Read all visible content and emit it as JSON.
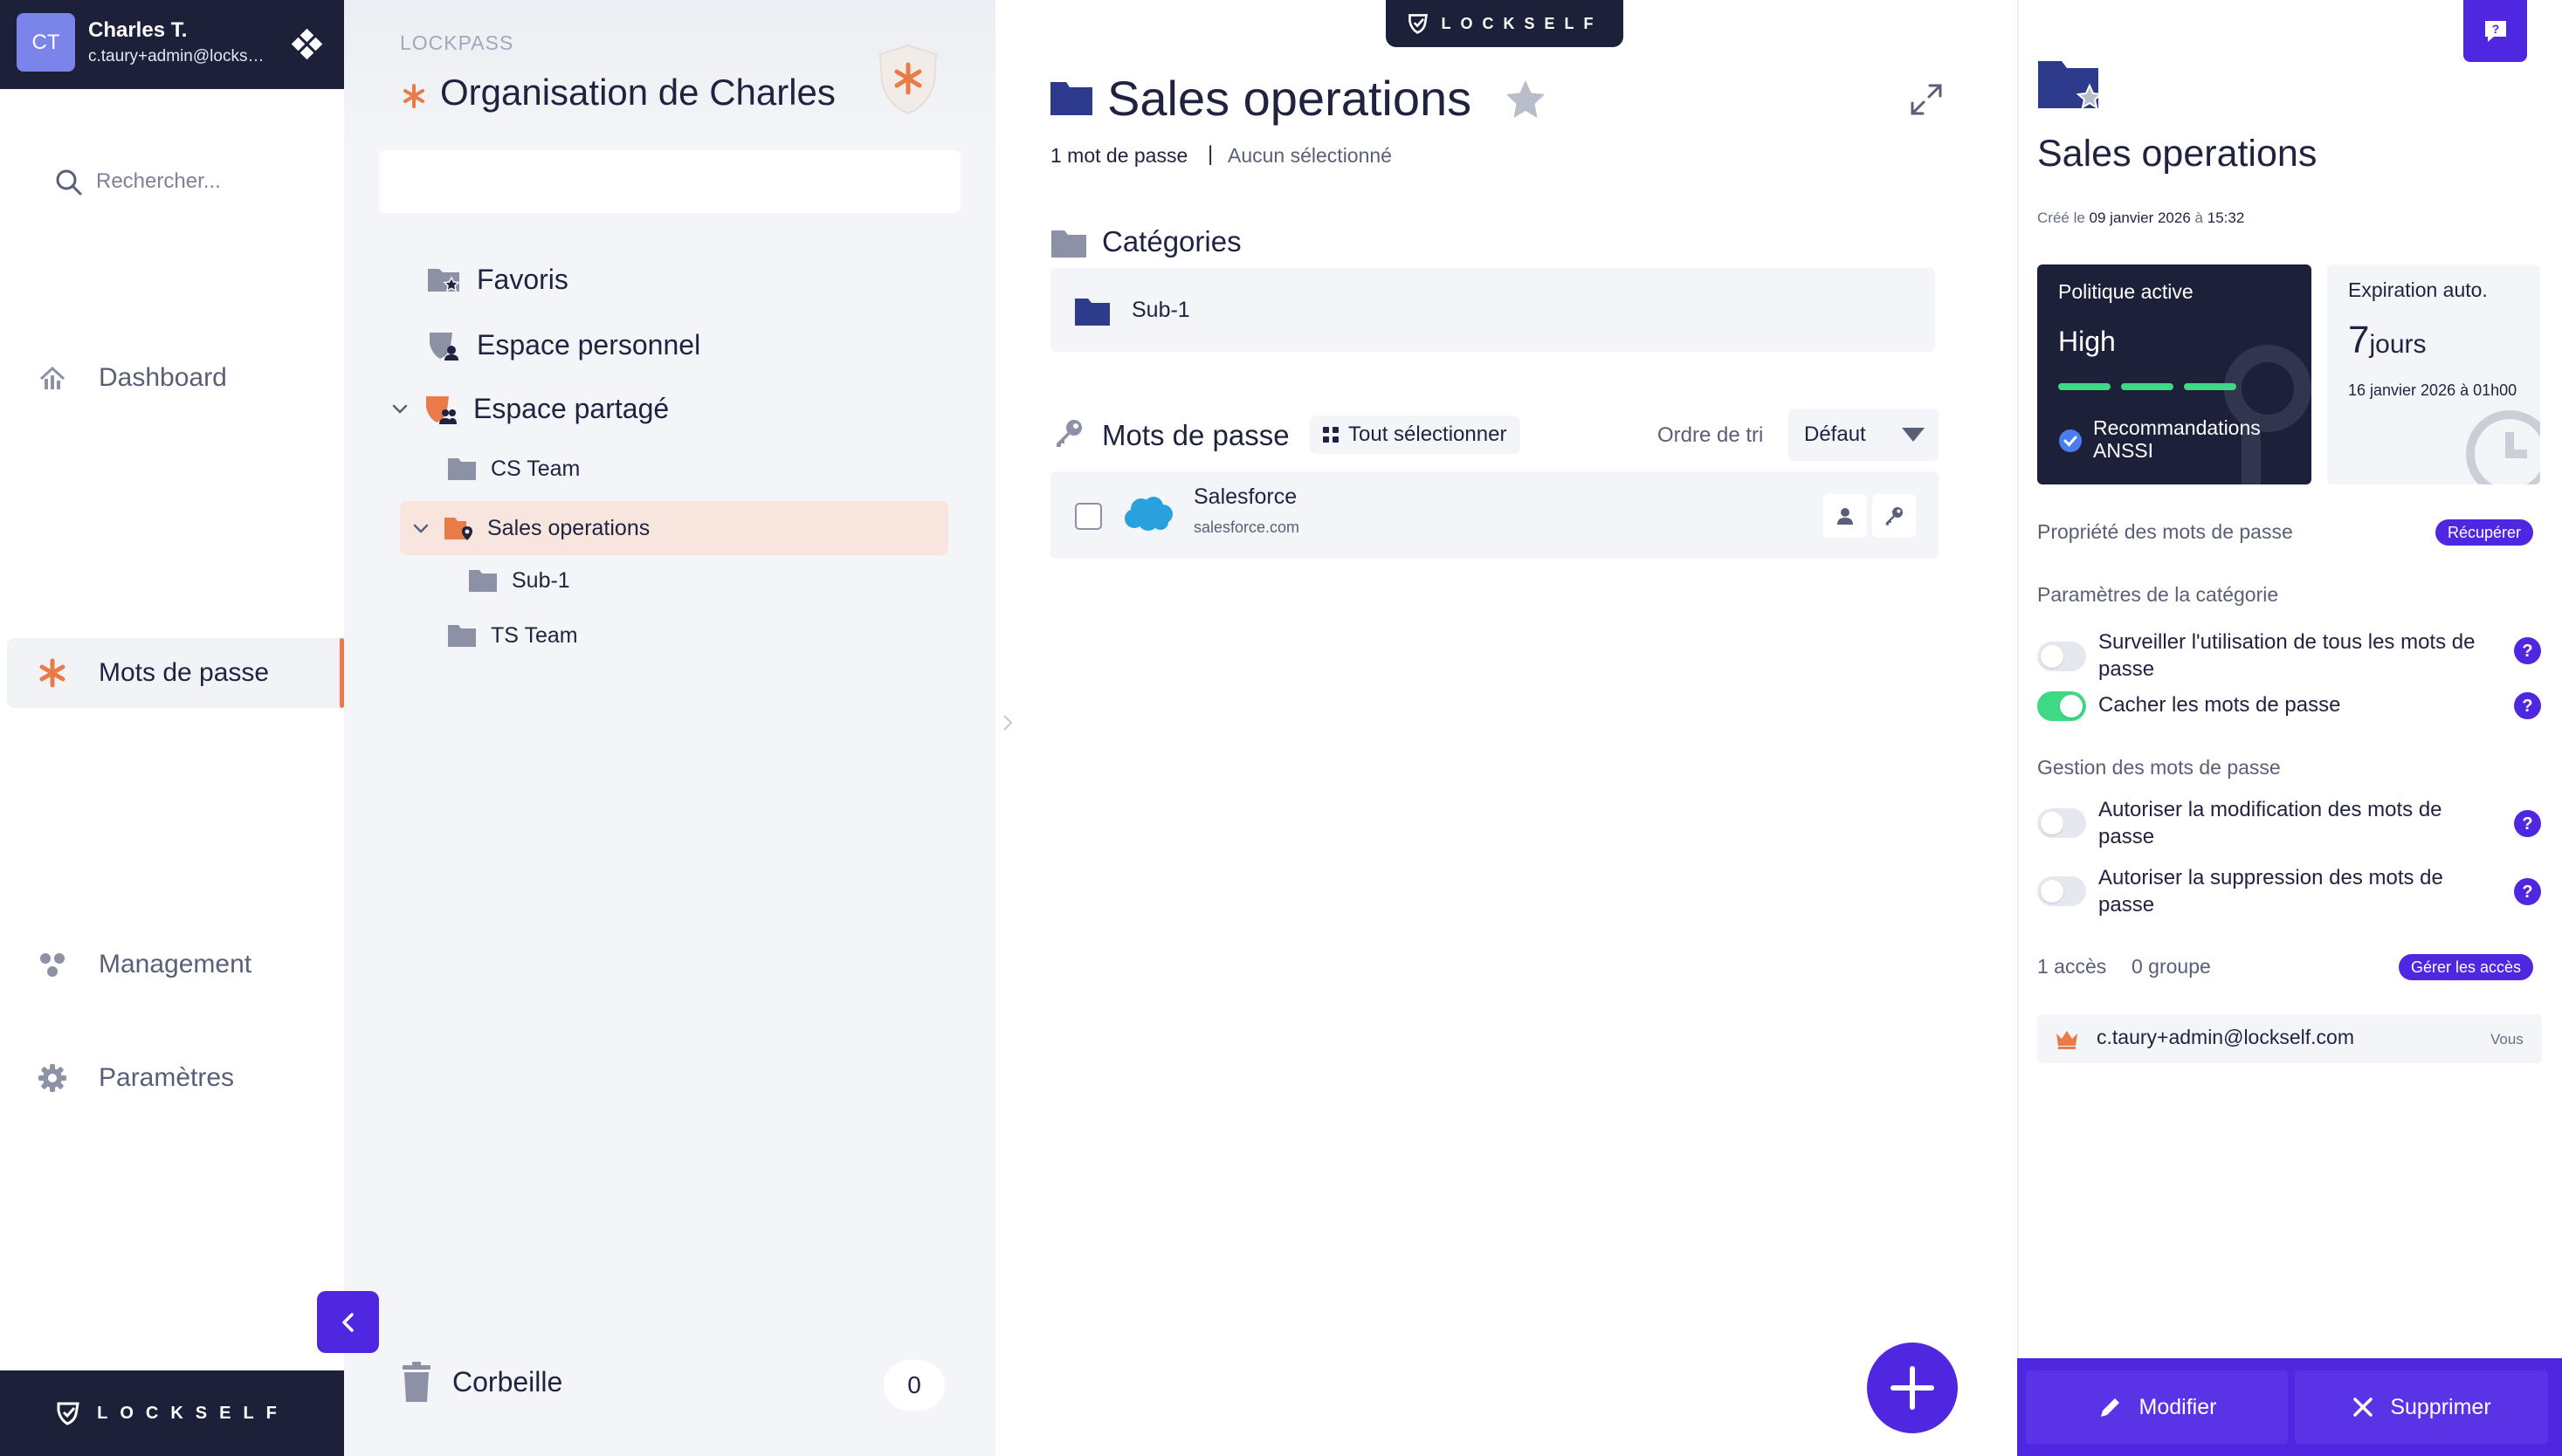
{
  "user": {
    "initials": "CT",
    "name": "Charles T.",
    "email": "c.taury+admin@lockself.com"
  },
  "nav": {
    "items": [
      {
        "label": "Dashboard",
        "icon": "dashboard-icon"
      },
      {
        "label": "Mots de passe",
        "icon": "asterisk-icon"
      },
      {
        "label": "Management",
        "icon": "management-icon"
      },
      {
        "label": "Paramètres",
        "icon": "gear-icon"
      }
    ],
    "brand": "LOCKSELF"
  },
  "tree": {
    "app_name": "LOCKPASS",
    "org_name": "Organisation de Charles",
    "search_placeholder": "Rechercher...",
    "items": [
      {
        "label": "Favoris"
      },
      {
        "label": "Espace personnel"
      },
      {
        "label": "Espace partagé"
      },
      {
        "label": "CS Team"
      },
      {
        "label": "Sales operations"
      },
      {
        "label": "Sub-1"
      },
      {
        "label": "TS Team"
      }
    ],
    "trash": {
      "label": "Corbeille",
      "count": "0"
    }
  },
  "main": {
    "brand": "LOCKSELF",
    "title": "Sales operations",
    "password_count": "1 mot de passe",
    "separator": "|",
    "selection_status": "Aucun sélectionné",
    "categories_title": "Catégories",
    "categories": [
      {
        "label": "Sub-1"
      }
    ],
    "passwords_title": "Mots de passe",
    "select_all": "Tout sélectionner",
    "sort_label": "Ordre de tri",
    "sort_value": "Défaut",
    "passwords": [
      {
        "name": "Salesforce",
        "url": "salesforce.com"
      }
    ]
  },
  "details": {
    "title": "Sales operations",
    "created_prefix": "Créé le",
    "created_date": "09 janvier 2026",
    "created_at": "à",
    "created_time": "15:32",
    "policy": {
      "label": "Politique active",
      "level": "High",
      "strength_bars": 3,
      "recommendation": "Recommandations ANSSI"
    },
    "expiry": {
      "label": "Expiration auto.",
      "value": "7",
      "unit": "jours",
      "date": "16 janvier 2026 à 01h00"
    },
    "property_label": "Propriété des mots de passe",
    "recover_button": "Récupérer",
    "category_params_label": "Paramètres de la catégorie",
    "toggles": [
      {
        "label": "Surveiller l'utilisation de tous les mots de passe",
        "on": false
      },
      {
        "label": "Cacher les mots de passe",
        "on": true
      },
      {
        "label": "Autoriser la modification des mots de passe",
        "on": false
      },
      {
        "label": "Autoriser la suppression des mots de passe",
        "on": false
      }
    ],
    "management_label": "Gestion des mots de passe",
    "access_count": "1 accès",
    "group_count": "0 groupe",
    "manage_access_button": "Gérer les accès",
    "members": [
      {
        "email": "c.taury+admin@lockself.com",
        "tag": "Vous"
      }
    ],
    "edit_button": "Modifier",
    "delete_button": "Supprimer"
  },
  "colors": {
    "primary": "#4f27e0",
    "dark": "#1c2038",
    "accent": "#e97b48",
    "success": "#3ed984",
    "folder": "#2e3a8c"
  }
}
